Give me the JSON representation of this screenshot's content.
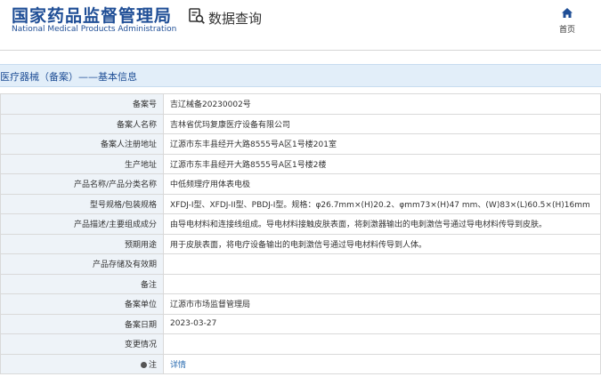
{
  "header": {
    "logo_cn": "国家药品监督管理局",
    "logo_en": "National Medical Products Administration",
    "query_label": "数据查询",
    "home_label": "首页"
  },
  "section": {
    "title": "医疗器械（备案）——基本信息"
  },
  "rows": [
    {
      "label": "备案号",
      "value": "吉辽械备20230002号"
    },
    {
      "label": "备案人名称",
      "value": "吉林省优玛复康医疗设备有限公司"
    },
    {
      "label": "备案人注册地址",
      "value": "辽源市东丰县经开大路8555号A区1号楼201室"
    },
    {
      "label": "生产地址",
      "value": "辽源市东丰县经开大路8555号A区1号楼2楼"
    },
    {
      "label": "产品名称/产品分类名称",
      "value": "中低频理疗用体表电极"
    },
    {
      "label": "型号规格/包装规格",
      "value": "XFDJ-I型、XFDJ-II型、PBDJ-I型。规格：φ26.7mm×(H)20.2、φmm73×(H)47 mm、(W)83×(L)60.5×(H)16mm"
    },
    {
      "label": "产品描述/主要组成成分",
      "value": "由导电材料和连接线组成。导电材料接触皮肤表面，将刺激器输出的电刺激信号通过导电材料传导到皮肤。"
    },
    {
      "label": "预期用途",
      "value": "用于皮肤表面，将电疗设备输出的电刺激信号通过导电材料传导到人体。"
    },
    {
      "label": "产品存储及有效期",
      "value": ""
    },
    {
      "label": "备注",
      "value": ""
    },
    {
      "label": "备案单位",
      "value": "辽源市市场监督管理局"
    },
    {
      "label": "备案日期",
      "value": "2023-03-27"
    },
    {
      "label": "变更情况",
      "value": ""
    }
  ],
  "note_row": {
    "label": "注",
    "value": "详情"
  },
  "icons": {
    "query": "search-document-icon",
    "home": "home-icon",
    "note": "location-pin-icon"
  },
  "colors": {
    "brand": "#1f4e96",
    "section_bg": "#e2eef9",
    "label_bg": "#eef3f8",
    "link": "#2b6cb0"
  }
}
